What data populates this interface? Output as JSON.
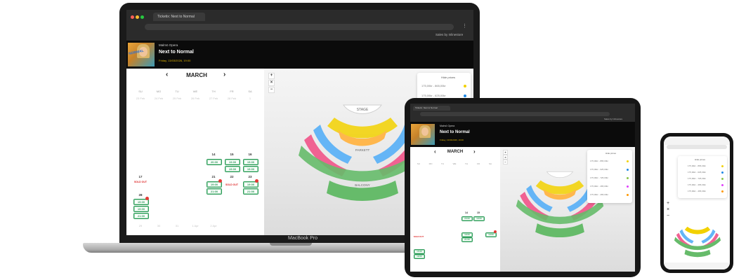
{
  "browser": {
    "tab_title": "Ticketix: Next to Normal",
    "extra_label": "Sales by Inlinestore"
  },
  "event": {
    "venue": "Malmö Opera",
    "title": "Next to Normal",
    "date": "Friday, 13/03/2026, 19:00",
    "poster_text": "NORMAL"
  },
  "calendar": {
    "month": "MARCH",
    "prev": "‹",
    "next": "›",
    "weekdays": [
      "SU",
      "MO",
      "TU",
      "WE",
      "TH",
      "FR",
      "SA"
    ],
    "first_row": [
      "23 Feb",
      "24 Feb",
      "25 Feb",
      "26 Feb",
      "27 Feb",
      "28 Feb",
      "1"
    ],
    "days": {
      "d14": "14",
      "d15": "15",
      "d16": "16",
      "d17": "17",
      "d21": "21",
      "d22": "22",
      "d23": "23",
      "d28": "28",
      "last_row": [
        "29",
        "30",
        "31",
        "1 Apr",
        "2 Apr",
        "3 Apr",
        "4 Apr"
      ]
    },
    "shows": {
      "t14": "20:00",
      "t15a": "19:00",
      "t15b": "19:00",
      "t16a": "15:00",
      "t16b": "19:00",
      "t21a": "19:00",
      "t21b": "21:00",
      "t23a": "19:00",
      "t23b": "21:00",
      "t28a": "15:00",
      "t28b": "19:00",
      "t28c": "21:00"
    },
    "sold_out": "SOLD OUT",
    "sold_out_short": "SOLD OUT"
  },
  "map": {
    "zoom_in": "+",
    "zoom_reset": "×",
    "zoom_out": "−",
    "stage": "STAGE",
    "parkett": "PARKETT",
    "balcony": "BALCONY"
  },
  "legend": {
    "header": "Hide prices",
    "rows": [
      {
        "label": "175,00kr - 865,00kr",
        "color": "#f2d100"
      },
      {
        "label": "175,00kr - 625,00kr",
        "color": "#1e88e5"
      },
      {
        "label": "175,00kr - 725,00kr",
        "color": "#8bc34a"
      },
      {
        "label": "175,00kr - 465,00kr",
        "color": "#e040fb"
      },
      {
        "label": "175,00kr - 465,00kr",
        "color": "#ff9800"
      }
    ]
  },
  "devices": {
    "laptop_label": "MacBook Pro"
  },
  "colors": {
    "accent_green": "#2e9b5a",
    "sold_red": "#e53935",
    "gold": "#e0b400",
    "seat_yellow": "#f2d100",
    "seat_blue": "#1e88e5",
    "seat_green": "#4caf50",
    "seat_pink": "#e040fb",
    "seat_orange": "#ff9800"
  }
}
